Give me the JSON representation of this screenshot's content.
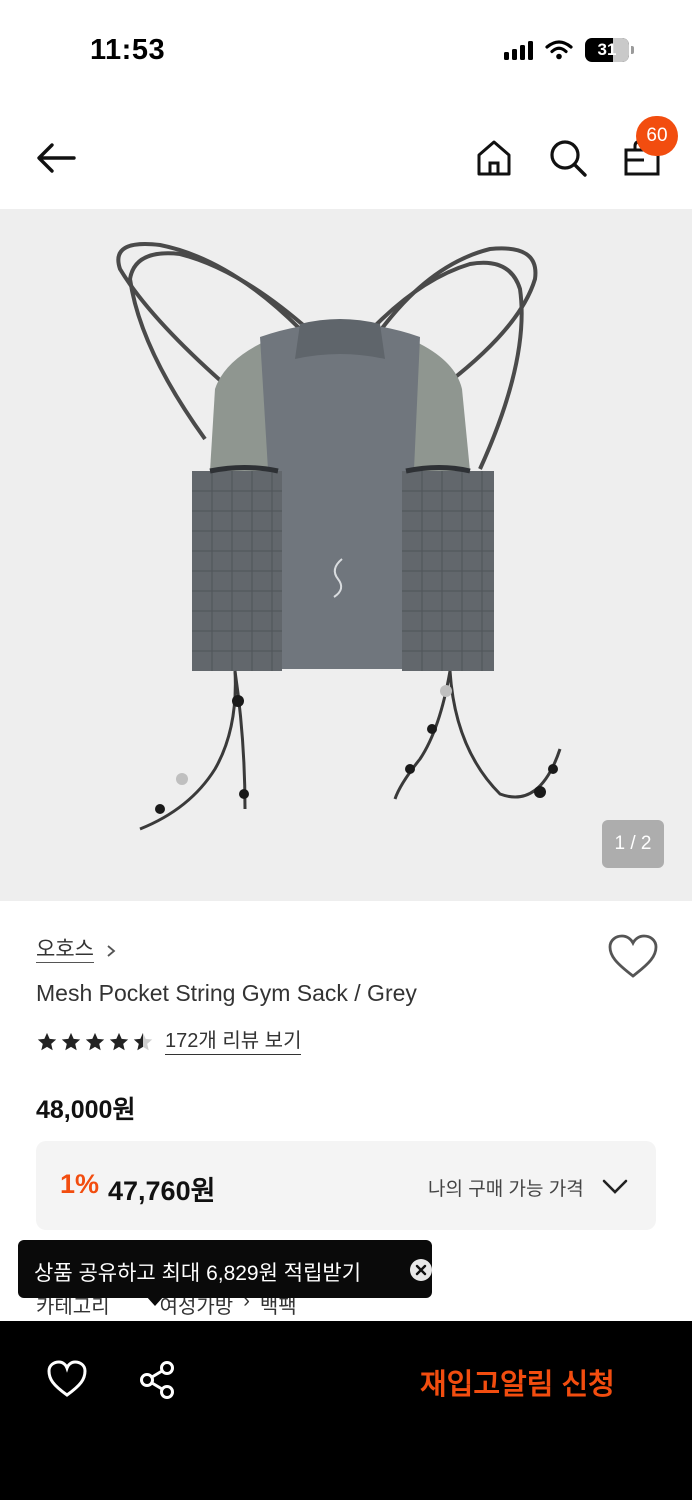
{
  "status_bar": {
    "time": "11:53",
    "battery": "31"
  },
  "header": {
    "icons": [
      "back-arrow-icon",
      "home-icon",
      "search-icon",
      "shopping-bag-icon"
    ],
    "cart_count": "60"
  },
  "gallery": {
    "page_indicator": "1 / 2"
  },
  "product": {
    "brand": "오호스",
    "name": "Mesh Pocket String Gym Sack / Grey",
    "rating": 4.5,
    "rating_max": 5,
    "review_link": "172개 리뷰 보기",
    "price": "48,000원"
  },
  "price_box": {
    "discount_rate": "1%",
    "discount_price": "47,760원",
    "my_price_label": "나의 구매 가능 가격"
  },
  "category": {
    "label": "카테고리",
    "path": [
      "여성가방",
      "백팩"
    ]
  },
  "toast": {
    "text": "상품 공유하고 최대 6,829원 적립받기"
  },
  "bottom_bar": {
    "cta": "재입고알림 신청"
  },
  "colors": {
    "accent": "#f24d0f",
    "dark": "#000000",
    "price_box_bg": "#f4f4f4",
    "hero_bg": "#eeeeee"
  }
}
